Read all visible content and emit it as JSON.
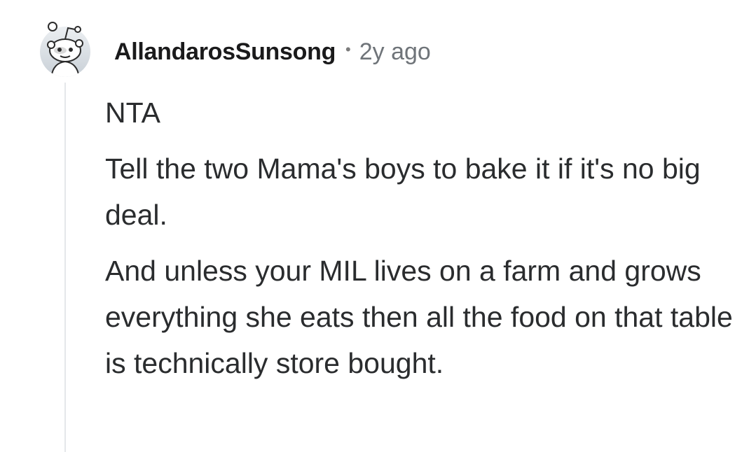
{
  "comment": {
    "avatar_icon": "reddit-snoo-avatar-icon",
    "username": "AllandarosSunsong",
    "separator": "•",
    "timestamp": "2y ago",
    "paragraphs": [
      "NTA",
      "Tell the two Mama's boys to bake it if it's no big deal.",
      "And unless your MIL lives on a farm and grows everything she eats then all the food on that table is technically store bought."
    ]
  },
  "colors": {
    "username": "#1a1a1b",
    "timestamp": "#6f7479",
    "body_text": "#2a2c2e",
    "thread_line": "#e5e7ea",
    "avatar_bg": "#d8dde2"
  }
}
